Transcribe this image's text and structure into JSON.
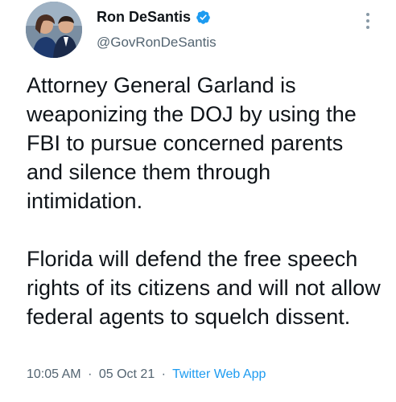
{
  "author": {
    "display_name": "Ron DeSantis",
    "handle": "@GovRonDeSantis",
    "verified": true
  },
  "tweet": {
    "paragraph_1": "Attorney General Garland is weaponizing the DOJ by using the FBI to pursue concerned parents and silence them through intimidation.",
    "paragraph_2": "Florida will defend the free speech rights of its citizens and will not allow federal agents to squelch dissent."
  },
  "meta": {
    "time": "10:05 AM",
    "separator": "·",
    "date": "05 Oct 21",
    "source": "Twitter Web App"
  },
  "colors": {
    "text": "#0f1419",
    "secondary": "#536471",
    "link": "#1d9bf0",
    "verified": "#1d9bf0"
  },
  "icons": {
    "verified": "verified-badge-icon",
    "more": "more-options-icon"
  }
}
